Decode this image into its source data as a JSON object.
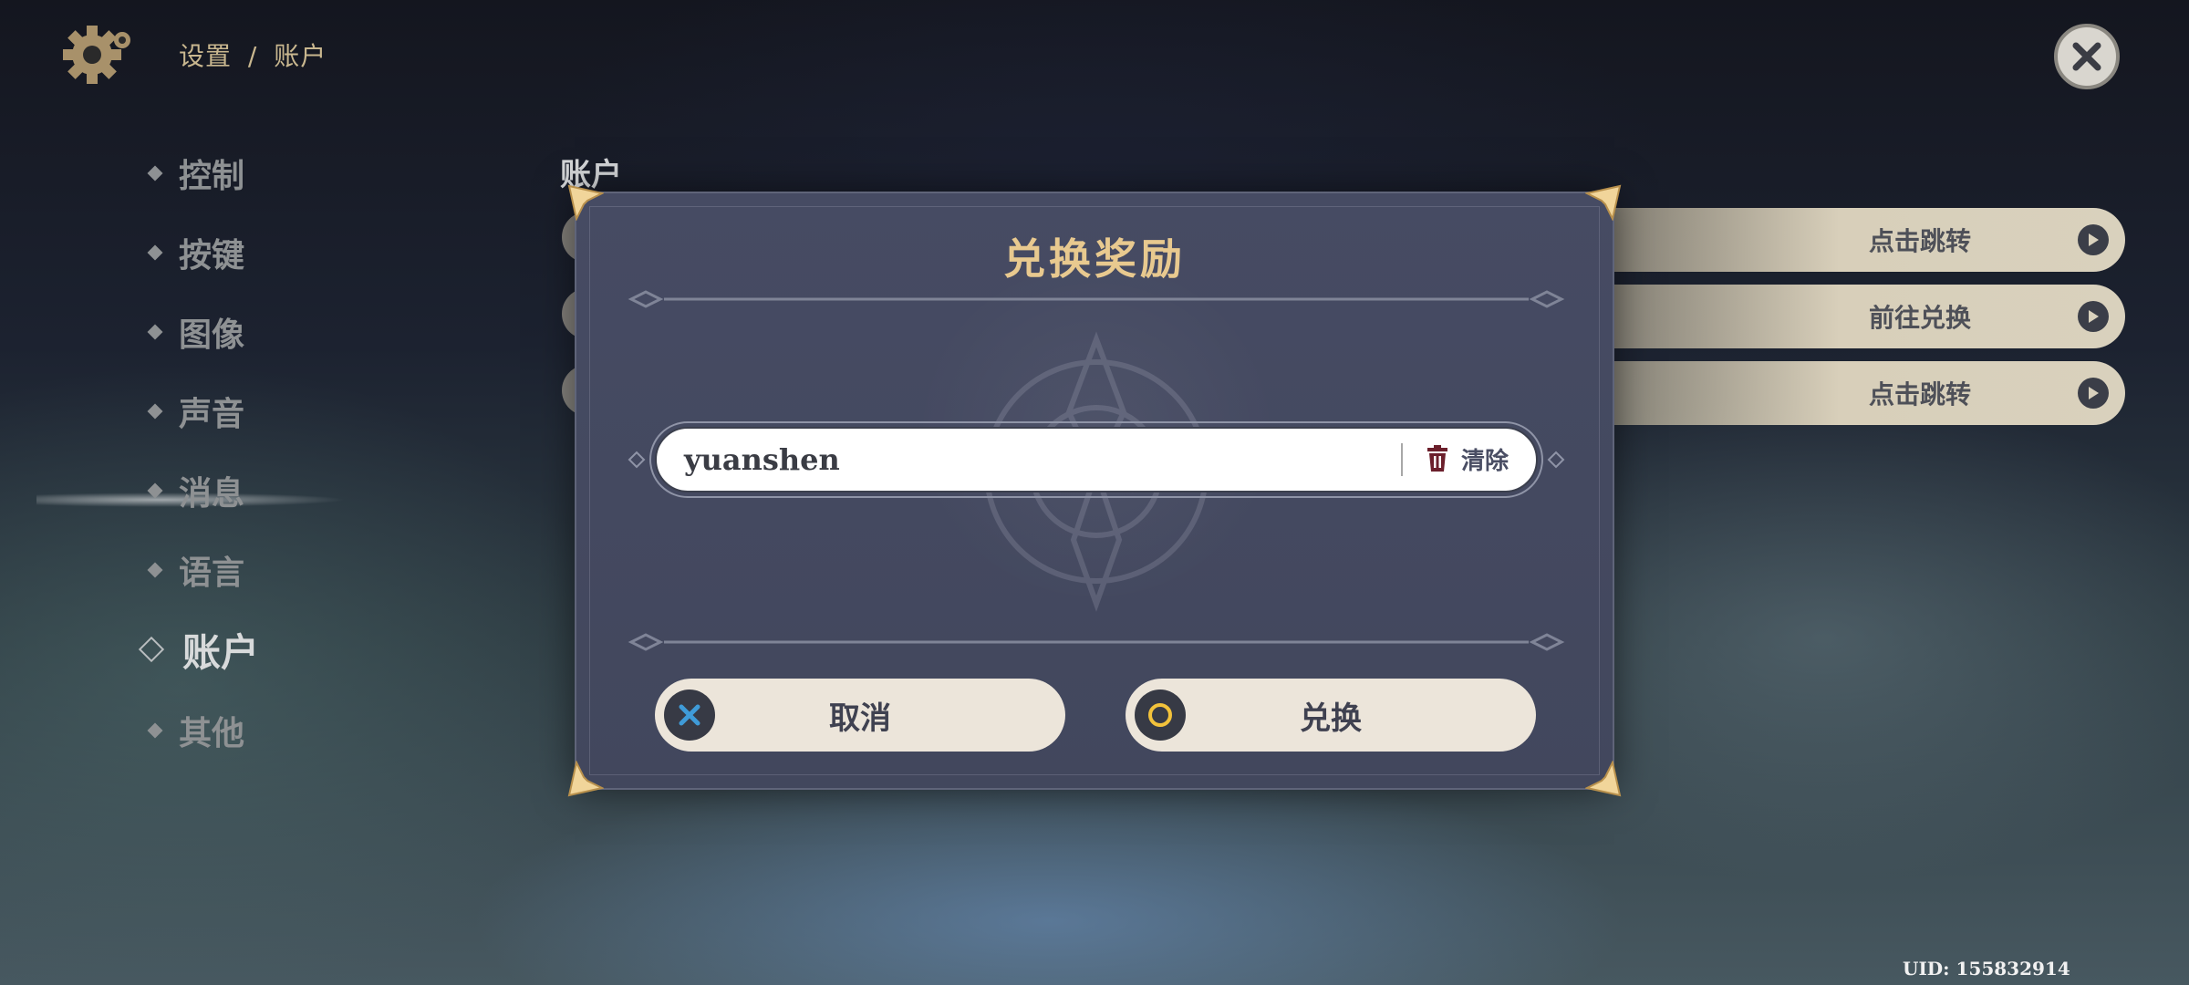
{
  "header": {
    "breadcrumb": [
      "设置",
      "账户"
    ],
    "breadcrumb_separator": "/"
  },
  "sidebar": {
    "items": [
      {
        "label": "控制",
        "active": false
      },
      {
        "label": "按键",
        "active": false
      },
      {
        "label": "图像",
        "active": false
      },
      {
        "label": "声音",
        "active": false
      },
      {
        "label": "消息",
        "active": false
      },
      {
        "label": "语言",
        "active": false
      },
      {
        "label": "账户",
        "active": true
      },
      {
        "label": "其他",
        "active": false
      }
    ]
  },
  "main": {
    "section_title": "账户",
    "actions": [
      {
        "label": "点击跳转"
      },
      {
        "label": "前往兑换"
      },
      {
        "label": "点击跳转"
      }
    ]
  },
  "modal": {
    "title": "兑换奖励",
    "input_value": "yuanshen",
    "clear_label": "清除",
    "cancel_label": "取消",
    "confirm_label": "兑换"
  },
  "footer": {
    "uid": "UID: 155832914"
  },
  "colors": {
    "gold": "#e8c98f",
    "modal_bg": "#464b63",
    "button_bg": "#ece5da",
    "cancel_icon": "#3f9bd8",
    "confirm_icon": "#f2c23b",
    "trash_icon": "#6b1f2b"
  }
}
